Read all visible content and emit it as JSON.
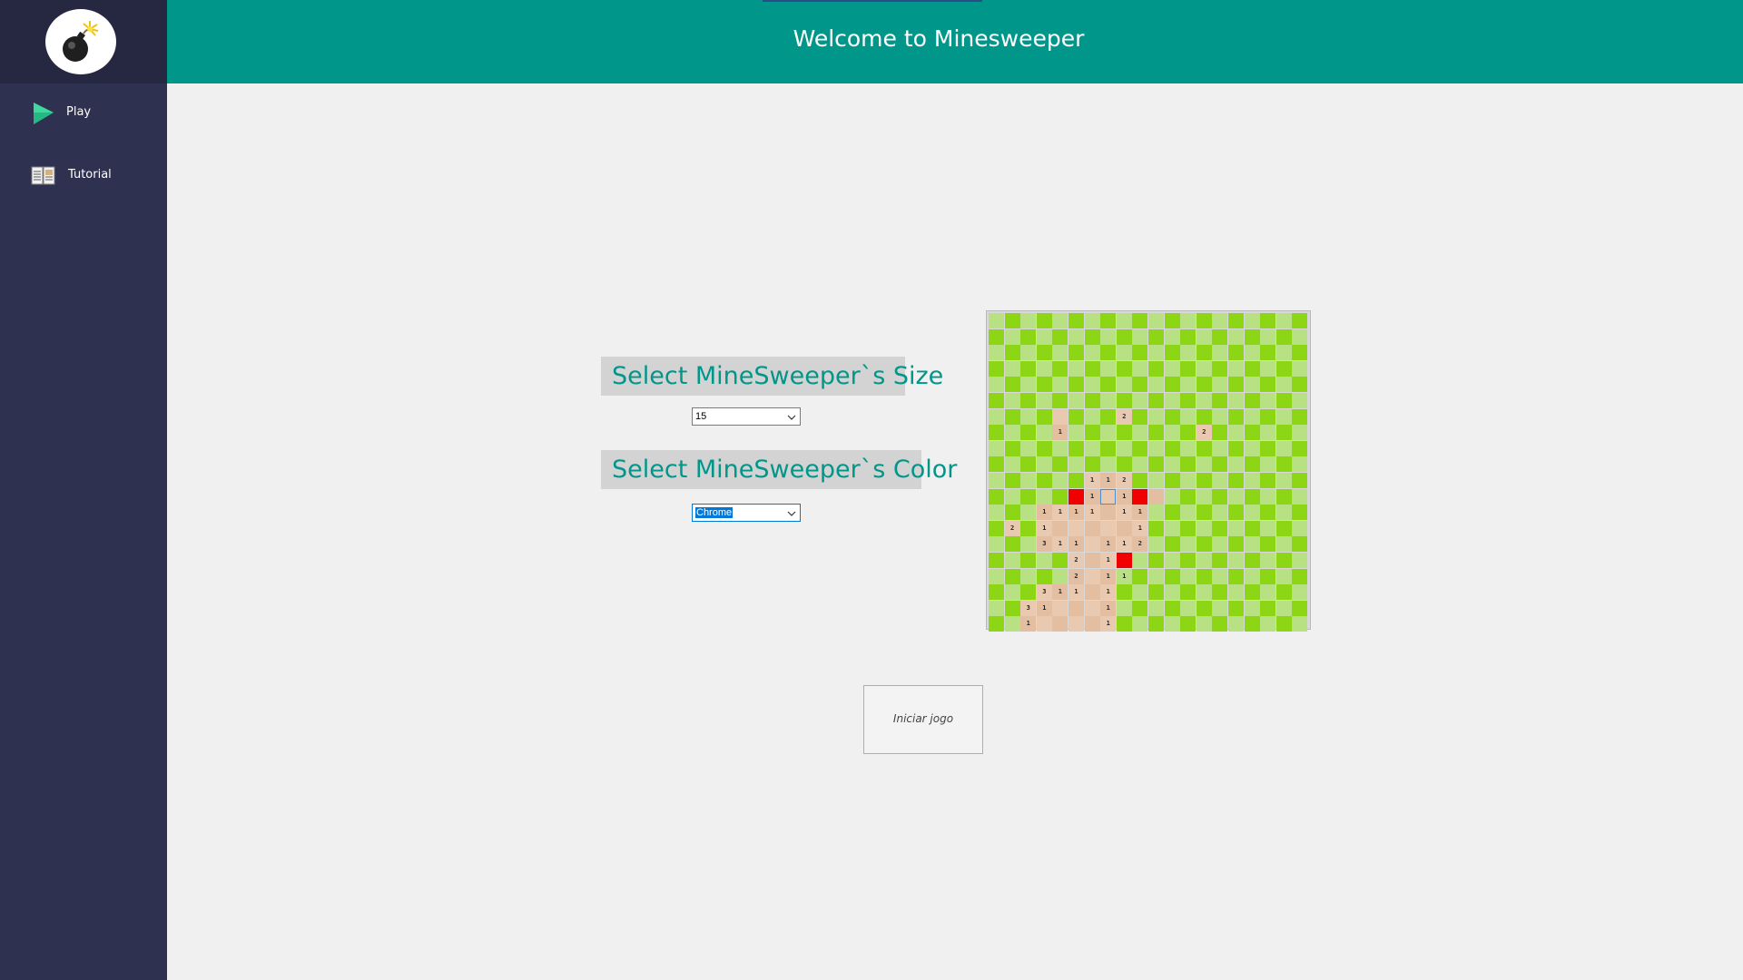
{
  "app": {
    "title": "Welcome to Minesweeper"
  },
  "sidebar": {
    "items": [
      {
        "label": "Play",
        "icon": "play-icon"
      },
      {
        "label": "Tutorial",
        "icon": "book-icon"
      }
    ]
  },
  "settings": {
    "size_label": "Select MineSweeper`s Size",
    "size_value": "15",
    "color_label": "Select MineSweeper`s Color",
    "color_value": "Chrome"
  },
  "start_button_label": "Iniciar jogo",
  "board": {
    "rows": 20,
    "cols": 20,
    "colors": {
      "hidden_dark": "#8dd616",
      "hidden_light": "#b8e184",
      "revealed_dark": "#e4bea0",
      "revealed_light": "#e9cab1",
      "mine": "#f00000"
    },
    "revealed_cells": [
      [
        6,
        4
      ],
      [
        6,
        8
      ],
      [
        7,
        4
      ],
      [
        7,
        13
      ],
      [
        10,
        6
      ],
      [
        10,
        7
      ],
      [
        10,
        8
      ],
      [
        11,
        6
      ],
      [
        11,
        7
      ],
      [
        11,
        8
      ],
      [
        11,
        9
      ],
      [
        11,
        10
      ],
      [
        12,
        3
      ],
      [
        12,
        4
      ],
      [
        12,
        5
      ],
      [
        12,
        6
      ],
      [
        12,
        7
      ],
      [
        12,
        8
      ],
      [
        12,
        9
      ],
      [
        13,
        1
      ],
      [
        13,
        3
      ],
      [
        13,
        4
      ],
      [
        13,
        5
      ],
      [
        13,
        6
      ],
      [
        13,
        7
      ],
      [
        13,
        8
      ],
      [
        13,
        9
      ],
      [
        14,
        3
      ],
      [
        14,
        4
      ],
      [
        14,
        5
      ],
      [
        14,
        6
      ],
      [
        14,
        7
      ],
      [
        14,
        8
      ],
      [
        14,
        9
      ],
      [
        15,
        5
      ],
      [
        15,
        6
      ],
      [
        15,
        7
      ],
      [
        16,
        5
      ],
      [
        16,
        6
      ],
      [
        16,
        7
      ],
      [
        17,
        3
      ],
      [
        17,
        4
      ],
      [
        17,
        5
      ],
      [
        17,
        6
      ],
      [
        17,
        7
      ],
      [
        18,
        2
      ],
      [
        18,
        3
      ],
      [
        18,
        4
      ],
      [
        18,
        5
      ],
      [
        18,
        6
      ],
      [
        18,
        7
      ],
      [
        19,
        2
      ],
      [
        19,
        3
      ],
      [
        19,
        4
      ],
      [
        19,
        5
      ],
      [
        19,
        6
      ],
      [
        19,
        7
      ]
    ],
    "numbers": [
      [
        6,
        8,
        "2"
      ],
      [
        7,
        4,
        "1"
      ],
      [
        7,
        13,
        "2"
      ],
      [
        10,
        6,
        "1"
      ],
      [
        10,
        7,
        "1"
      ],
      [
        10,
        8,
        "2"
      ],
      [
        11,
        6,
        "1"
      ],
      [
        11,
        8,
        "1"
      ],
      [
        12,
        3,
        "1"
      ],
      [
        12,
        4,
        "1"
      ],
      [
        12,
        5,
        "1"
      ],
      [
        12,
        6,
        "1"
      ],
      [
        12,
        8,
        "1"
      ],
      [
        12,
        9,
        "1"
      ],
      [
        13,
        1,
        "2"
      ],
      [
        13,
        3,
        "1"
      ],
      [
        13,
        9,
        "1"
      ],
      [
        14,
        3,
        "3"
      ],
      [
        14,
        4,
        "1"
      ],
      [
        14,
        5,
        "1"
      ],
      [
        14,
        7,
        "1"
      ],
      [
        14,
        8,
        "1"
      ],
      [
        14,
        9,
        "2"
      ],
      [
        15,
        5,
        "2"
      ],
      [
        15,
        7,
        "1"
      ],
      [
        16,
        5,
        "2"
      ],
      [
        16,
        7,
        "1"
      ],
      [
        16,
        8,
        "1"
      ],
      [
        17,
        3,
        "3"
      ],
      [
        17,
        4,
        "1"
      ],
      [
        17,
        5,
        "1"
      ],
      [
        17,
        7,
        "1"
      ],
      [
        18,
        2,
        "3"
      ],
      [
        18,
        3,
        "1"
      ],
      [
        18,
        7,
        "1"
      ],
      [
        19,
        2,
        "1"
      ],
      [
        19,
        7,
        "1"
      ]
    ],
    "mines": [
      [
        11,
        5
      ],
      [
        11,
        9
      ],
      [
        15,
        8
      ]
    ],
    "focused_cell": [
      11,
      7
    ]
  }
}
